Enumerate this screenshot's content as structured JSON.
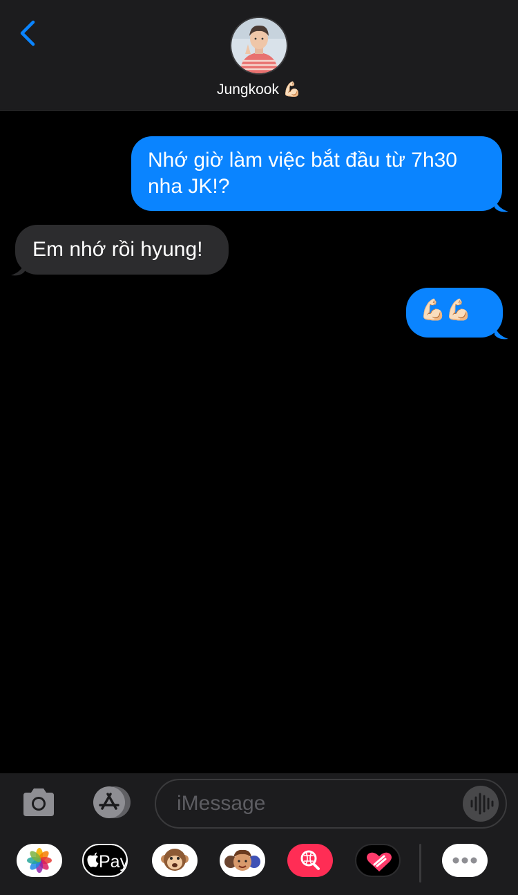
{
  "header": {
    "contact_name": "Jungkook 💪🏻",
    "back_icon": "chevron-left-icon"
  },
  "messages": [
    {
      "direction": "outgoing",
      "text": "Nhớ giờ làm việc bắt đầu từ 7h30 nha JK!?"
    },
    {
      "direction": "incoming",
      "text": "Em nhớ rồi hyung!"
    },
    {
      "direction": "outgoing",
      "text": "💪🏻💪🏻"
    }
  ],
  "compose": {
    "placeholder": "iMessage",
    "camera_icon": "camera-icon",
    "appstore_icon": "app-store-icon",
    "mic_icon": "audio-waveform-icon"
  },
  "app_drawer": {
    "apple_pay_label": "Pay",
    "items": [
      "photos-icon",
      "apple-pay-icon",
      "animoji-icon",
      "memoji-icon",
      "image-search-icon",
      "digital-touch-icon",
      "more-icon"
    ]
  },
  "colors": {
    "outgoing_bubble": "#0a84ff",
    "incoming_bubble": "#2c2c2e",
    "accent": "#0a84ff"
  }
}
